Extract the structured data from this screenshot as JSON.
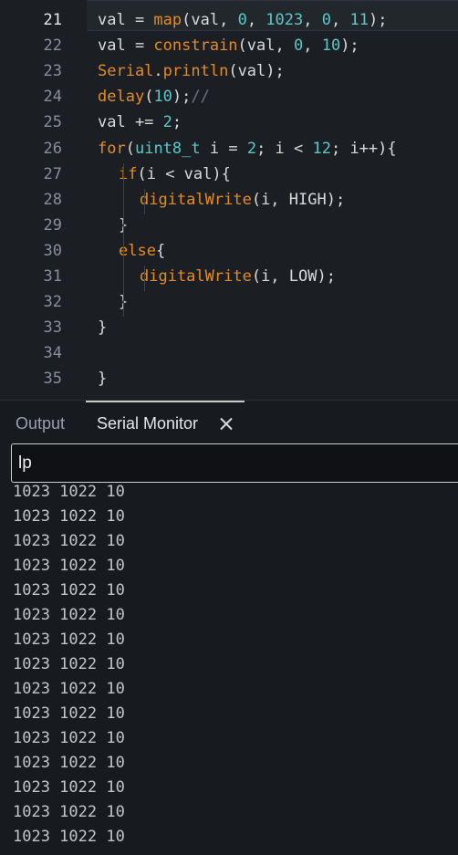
{
  "editor": {
    "lines": [
      {
        "number": "21",
        "active": true,
        "indent": 0,
        "tokens": [
          {
            "t": "val = ",
            "c": "plain"
          },
          {
            "t": "map",
            "c": "fn"
          },
          {
            "t": "(val, ",
            "c": "plain"
          },
          {
            "t": "0",
            "c": "num"
          },
          {
            "t": ", ",
            "c": "plain"
          },
          {
            "t": "1023",
            "c": "num"
          },
          {
            "t": ", ",
            "c": "plain"
          },
          {
            "t": "0",
            "c": "num"
          },
          {
            "t": ", ",
            "c": "plain"
          },
          {
            "t": "11",
            "c": "num"
          },
          {
            "t": ");",
            "c": "plain"
          }
        ]
      },
      {
        "number": "22",
        "indent": 0,
        "tokens": [
          {
            "t": "val = ",
            "c": "plain"
          },
          {
            "t": "constrain",
            "c": "fn"
          },
          {
            "t": "(val, ",
            "c": "plain"
          },
          {
            "t": "0",
            "c": "num"
          },
          {
            "t": ", ",
            "c": "plain"
          },
          {
            "t": "10",
            "c": "num"
          },
          {
            "t": ");",
            "c": "plain"
          }
        ]
      },
      {
        "number": "23",
        "indent": 0,
        "tokens": [
          {
            "t": "Serial",
            "c": "fn"
          },
          {
            "t": ".",
            "c": "plain"
          },
          {
            "t": "println",
            "c": "fn"
          },
          {
            "t": "(val);",
            "c": "plain"
          }
        ]
      },
      {
        "number": "24",
        "indent": 0,
        "tokens": [
          {
            "t": "delay",
            "c": "fn"
          },
          {
            "t": "(",
            "c": "plain"
          },
          {
            "t": "10",
            "c": "num"
          },
          {
            "t": ");",
            "c": "plain"
          },
          {
            "t": "//",
            "c": "cmt"
          }
        ]
      },
      {
        "number": "25",
        "indent": 0,
        "tokens": [
          {
            "t": "val += ",
            "c": "plain"
          },
          {
            "t": "2",
            "c": "num"
          },
          {
            "t": ";",
            "c": "plain"
          }
        ]
      },
      {
        "number": "26",
        "indent": 0,
        "tokens": [
          {
            "t": "for",
            "c": "kw"
          },
          {
            "t": "(",
            "c": "plain"
          },
          {
            "t": "uint8_t",
            "c": "typ"
          },
          {
            "t": " i = ",
            "c": "plain"
          },
          {
            "t": "2",
            "c": "num"
          },
          {
            "t": "; i < ",
            "c": "plain"
          },
          {
            "t": "12",
            "c": "num"
          },
          {
            "t": "; i++){",
            "c": "plain"
          }
        ]
      },
      {
        "number": "27",
        "indent": 1,
        "tokens": [
          {
            "t": "if",
            "c": "kw"
          },
          {
            "t": "(i < val){",
            "c": "plain"
          }
        ]
      },
      {
        "number": "28",
        "indent": 2,
        "tokens": [
          {
            "t": "digitalWrite",
            "c": "fn"
          },
          {
            "t": "(i, HIGH);",
            "c": "plain"
          }
        ]
      },
      {
        "number": "29",
        "indent": 1,
        "tokens": [
          {
            "t": "}",
            "c": "plain"
          }
        ]
      },
      {
        "number": "30",
        "indent": 1,
        "tokens": [
          {
            "t": "else",
            "c": "kw"
          },
          {
            "t": "{",
            "c": "plain"
          }
        ]
      },
      {
        "number": "31",
        "indent": 2,
        "tokens": [
          {
            "t": "digitalWrite",
            "c": "fn"
          },
          {
            "t": "(i, LOW);",
            "c": "plain"
          }
        ]
      },
      {
        "number": "32",
        "indent": 1,
        "tokens": [
          {
            "t": "}",
            "c": "plain"
          }
        ]
      },
      {
        "number": "33",
        "indent": 0,
        "tokens": [
          {
            "t": "}",
            "c": "plain"
          }
        ]
      },
      {
        "number": "34",
        "indent": 0,
        "tokens": []
      },
      {
        "number": "35",
        "indent": 0,
        "tokens": [
          {
            "t": "}",
            "c": "plain"
          }
        ]
      }
    ]
  },
  "panel": {
    "tabs": {
      "output_label": "Output",
      "serial_label": "Serial Monitor"
    },
    "close_icon": "close-icon"
  },
  "serial_input": {
    "value": "lp"
  },
  "serial_output": {
    "lines": [
      "1023 1022 10",
      "1023 1022 10",
      "1023 1022 10",
      "1023 1022 10",
      "1023 1022 10",
      "1023 1022 10",
      "1023 1022 10",
      "1023 1022 10",
      "1023 1022 10",
      "1023 1022 10",
      "1023 1022 10",
      "1023 1022 10",
      "1023 1022 10",
      "1023 1022 10",
      "1023 1022 10"
    ]
  },
  "colors": {
    "keyword": "#e58b26",
    "number": "#5cc8c8",
    "text": "#dadada",
    "background": "#1b1f23"
  }
}
